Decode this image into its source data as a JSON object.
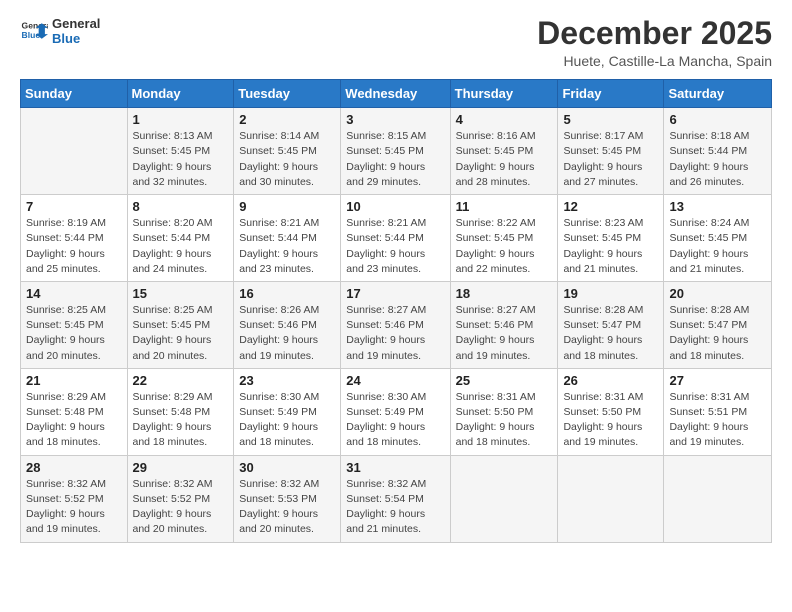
{
  "logo": {
    "line1": "General",
    "line2": "Blue"
  },
  "title": "December 2025",
  "location": "Huete, Castille-La Mancha, Spain",
  "days_header": [
    "Sunday",
    "Monday",
    "Tuesday",
    "Wednesday",
    "Thursday",
    "Friday",
    "Saturday"
  ],
  "weeks": [
    [
      {
        "day": "",
        "info": ""
      },
      {
        "day": "1",
        "info": "Sunrise: 8:13 AM\nSunset: 5:45 PM\nDaylight: 9 hours\nand 32 minutes."
      },
      {
        "day": "2",
        "info": "Sunrise: 8:14 AM\nSunset: 5:45 PM\nDaylight: 9 hours\nand 30 minutes."
      },
      {
        "day": "3",
        "info": "Sunrise: 8:15 AM\nSunset: 5:45 PM\nDaylight: 9 hours\nand 29 minutes."
      },
      {
        "day": "4",
        "info": "Sunrise: 8:16 AM\nSunset: 5:45 PM\nDaylight: 9 hours\nand 28 minutes."
      },
      {
        "day": "5",
        "info": "Sunrise: 8:17 AM\nSunset: 5:45 PM\nDaylight: 9 hours\nand 27 minutes."
      },
      {
        "day": "6",
        "info": "Sunrise: 8:18 AM\nSunset: 5:44 PM\nDaylight: 9 hours\nand 26 minutes."
      }
    ],
    [
      {
        "day": "7",
        "info": "Sunrise: 8:19 AM\nSunset: 5:44 PM\nDaylight: 9 hours\nand 25 minutes."
      },
      {
        "day": "8",
        "info": "Sunrise: 8:20 AM\nSunset: 5:44 PM\nDaylight: 9 hours\nand 24 minutes."
      },
      {
        "day": "9",
        "info": "Sunrise: 8:21 AM\nSunset: 5:44 PM\nDaylight: 9 hours\nand 23 minutes."
      },
      {
        "day": "10",
        "info": "Sunrise: 8:21 AM\nSunset: 5:44 PM\nDaylight: 9 hours\nand 23 minutes."
      },
      {
        "day": "11",
        "info": "Sunrise: 8:22 AM\nSunset: 5:45 PM\nDaylight: 9 hours\nand 22 minutes."
      },
      {
        "day": "12",
        "info": "Sunrise: 8:23 AM\nSunset: 5:45 PM\nDaylight: 9 hours\nand 21 minutes."
      },
      {
        "day": "13",
        "info": "Sunrise: 8:24 AM\nSunset: 5:45 PM\nDaylight: 9 hours\nand 21 minutes."
      }
    ],
    [
      {
        "day": "14",
        "info": "Sunrise: 8:25 AM\nSunset: 5:45 PM\nDaylight: 9 hours\nand 20 minutes."
      },
      {
        "day": "15",
        "info": "Sunrise: 8:25 AM\nSunset: 5:45 PM\nDaylight: 9 hours\nand 20 minutes."
      },
      {
        "day": "16",
        "info": "Sunrise: 8:26 AM\nSunset: 5:46 PM\nDaylight: 9 hours\nand 19 minutes."
      },
      {
        "day": "17",
        "info": "Sunrise: 8:27 AM\nSunset: 5:46 PM\nDaylight: 9 hours\nand 19 minutes."
      },
      {
        "day": "18",
        "info": "Sunrise: 8:27 AM\nSunset: 5:46 PM\nDaylight: 9 hours\nand 19 minutes."
      },
      {
        "day": "19",
        "info": "Sunrise: 8:28 AM\nSunset: 5:47 PM\nDaylight: 9 hours\nand 18 minutes."
      },
      {
        "day": "20",
        "info": "Sunrise: 8:28 AM\nSunset: 5:47 PM\nDaylight: 9 hours\nand 18 minutes."
      }
    ],
    [
      {
        "day": "21",
        "info": "Sunrise: 8:29 AM\nSunset: 5:48 PM\nDaylight: 9 hours\nand 18 minutes."
      },
      {
        "day": "22",
        "info": "Sunrise: 8:29 AM\nSunset: 5:48 PM\nDaylight: 9 hours\nand 18 minutes."
      },
      {
        "day": "23",
        "info": "Sunrise: 8:30 AM\nSunset: 5:49 PM\nDaylight: 9 hours\nand 18 minutes."
      },
      {
        "day": "24",
        "info": "Sunrise: 8:30 AM\nSunset: 5:49 PM\nDaylight: 9 hours\nand 18 minutes."
      },
      {
        "day": "25",
        "info": "Sunrise: 8:31 AM\nSunset: 5:50 PM\nDaylight: 9 hours\nand 18 minutes."
      },
      {
        "day": "26",
        "info": "Sunrise: 8:31 AM\nSunset: 5:50 PM\nDaylight: 9 hours\nand 19 minutes."
      },
      {
        "day": "27",
        "info": "Sunrise: 8:31 AM\nSunset: 5:51 PM\nDaylight: 9 hours\nand 19 minutes."
      }
    ],
    [
      {
        "day": "28",
        "info": "Sunrise: 8:32 AM\nSunset: 5:52 PM\nDaylight: 9 hours\nand 19 minutes."
      },
      {
        "day": "29",
        "info": "Sunrise: 8:32 AM\nSunset: 5:52 PM\nDaylight: 9 hours\nand 20 minutes."
      },
      {
        "day": "30",
        "info": "Sunrise: 8:32 AM\nSunset: 5:53 PM\nDaylight: 9 hours\nand 20 minutes."
      },
      {
        "day": "31",
        "info": "Sunrise: 8:32 AM\nSunset: 5:54 PM\nDaylight: 9 hours\nand 21 minutes."
      },
      {
        "day": "",
        "info": ""
      },
      {
        "day": "",
        "info": ""
      },
      {
        "day": "",
        "info": ""
      }
    ]
  ]
}
